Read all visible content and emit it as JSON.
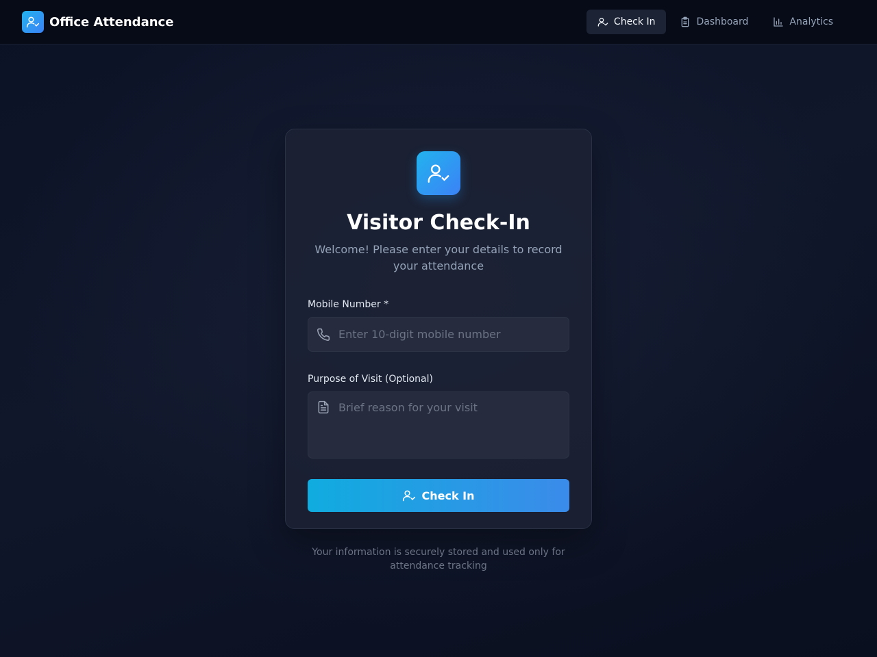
{
  "app": {
    "title": "Office Attendance"
  },
  "nav": {
    "items": [
      {
        "label": "Check In",
        "icon": "user-check-icon",
        "active": true
      },
      {
        "label": "Dashboard",
        "icon": "clipboard-icon",
        "active": false
      },
      {
        "label": "Analytics",
        "icon": "bar-chart-icon",
        "active": false
      }
    ]
  },
  "card": {
    "icon": "user-check-icon",
    "title": "Visitor Check-In",
    "subtitle": "Welcome! Please enter your details to record your attendance"
  },
  "form": {
    "mobile": {
      "label": "Mobile Number *",
      "placeholder": "Enter 10-digit mobile number",
      "icon": "phone-icon",
      "value": ""
    },
    "purpose": {
      "label": "Purpose of Visit (Optional)",
      "placeholder": "Brief reason for your visit",
      "icon": "document-icon",
      "value": ""
    },
    "submit_label": "Check In"
  },
  "footer": {
    "note": "Your information is securely stored and used only for attendance tracking"
  },
  "colors": {
    "accent_start": "#22b3ee",
    "accent_end": "#3b82f6",
    "background": "#0b1020",
    "card": "#1e2334"
  }
}
